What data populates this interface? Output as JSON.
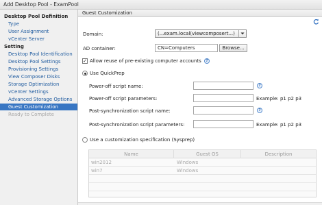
{
  "window": {
    "title": "Add Desktop Pool - ExamPool"
  },
  "sidebar": {
    "items": [
      {
        "label": "Desktop Pool Definition",
        "kind": "section"
      },
      {
        "label": "Type",
        "kind": "link"
      },
      {
        "label": "User Assignment",
        "kind": "link"
      },
      {
        "label": "vCenter Server",
        "kind": "link"
      },
      {
        "label": "Setting",
        "kind": "section"
      },
      {
        "label": "Desktop Pool Identification",
        "kind": "link"
      },
      {
        "label": "Desktop Pool Settings",
        "kind": "link"
      },
      {
        "label": "Provisioning Settings",
        "kind": "link"
      },
      {
        "label": "View Composer Disks",
        "kind": "link"
      },
      {
        "label": "Storage Optimization",
        "kind": "link"
      },
      {
        "label": "vCenter Settings",
        "kind": "link"
      },
      {
        "label": "Advanced Storage Options",
        "kind": "link"
      },
      {
        "label": "Guest Customization",
        "kind": "selected"
      },
      {
        "label": "Ready to Complete",
        "kind": "disabled"
      }
    ]
  },
  "main": {
    "header": "Guest Customization",
    "domain": {
      "label": "Domain:",
      "value": "(...exam.local(viewcomposert...)"
    },
    "ad_container": {
      "label": "AD container:",
      "value": "CN=Computers",
      "browse_label": "Browse..."
    },
    "allow_reuse": {
      "label": "Allow reuse of pre-existing computer accounts",
      "checked": true
    },
    "quickprep": {
      "label": "Use QuickPrep",
      "selected": true,
      "poweroff_name": {
        "label": "Power-off script name:",
        "value": ""
      },
      "poweroff_params": {
        "label": "Power-off script parameters:",
        "value": "",
        "example": "Example: p1 p2 p3"
      },
      "postsync_name": {
        "label": "Post-synchronization script name:",
        "value": ""
      },
      "postsync_params": {
        "label": "Post-synchronization script parameters:",
        "value": "",
        "example": "Example: p1 p2 p3"
      }
    },
    "sysprep": {
      "label": "Use a customization specification (Sysprep)",
      "selected": false,
      "columns": [
        "Name",
        "Guest OS",
        "Description"
      ],
      "rows": [
        {
          "name": "win2012",
          "guest_os": "Windows",
          "description": ""
        },
        {
          "name": "win7",
          "guest_os": "Windows",
          "description": ""
        }
      ]
    }
  },
  "icons": {
    "help": "help-icon",
    "refresh": "refresh-icon",
    "dropdown": "chevron-down-icon"
  },
  "colors": {
    "selected_bg": "#3876c3",
    "link": "#1f5b9f",
    "disabled": "#a8a8a8"
  }
}
